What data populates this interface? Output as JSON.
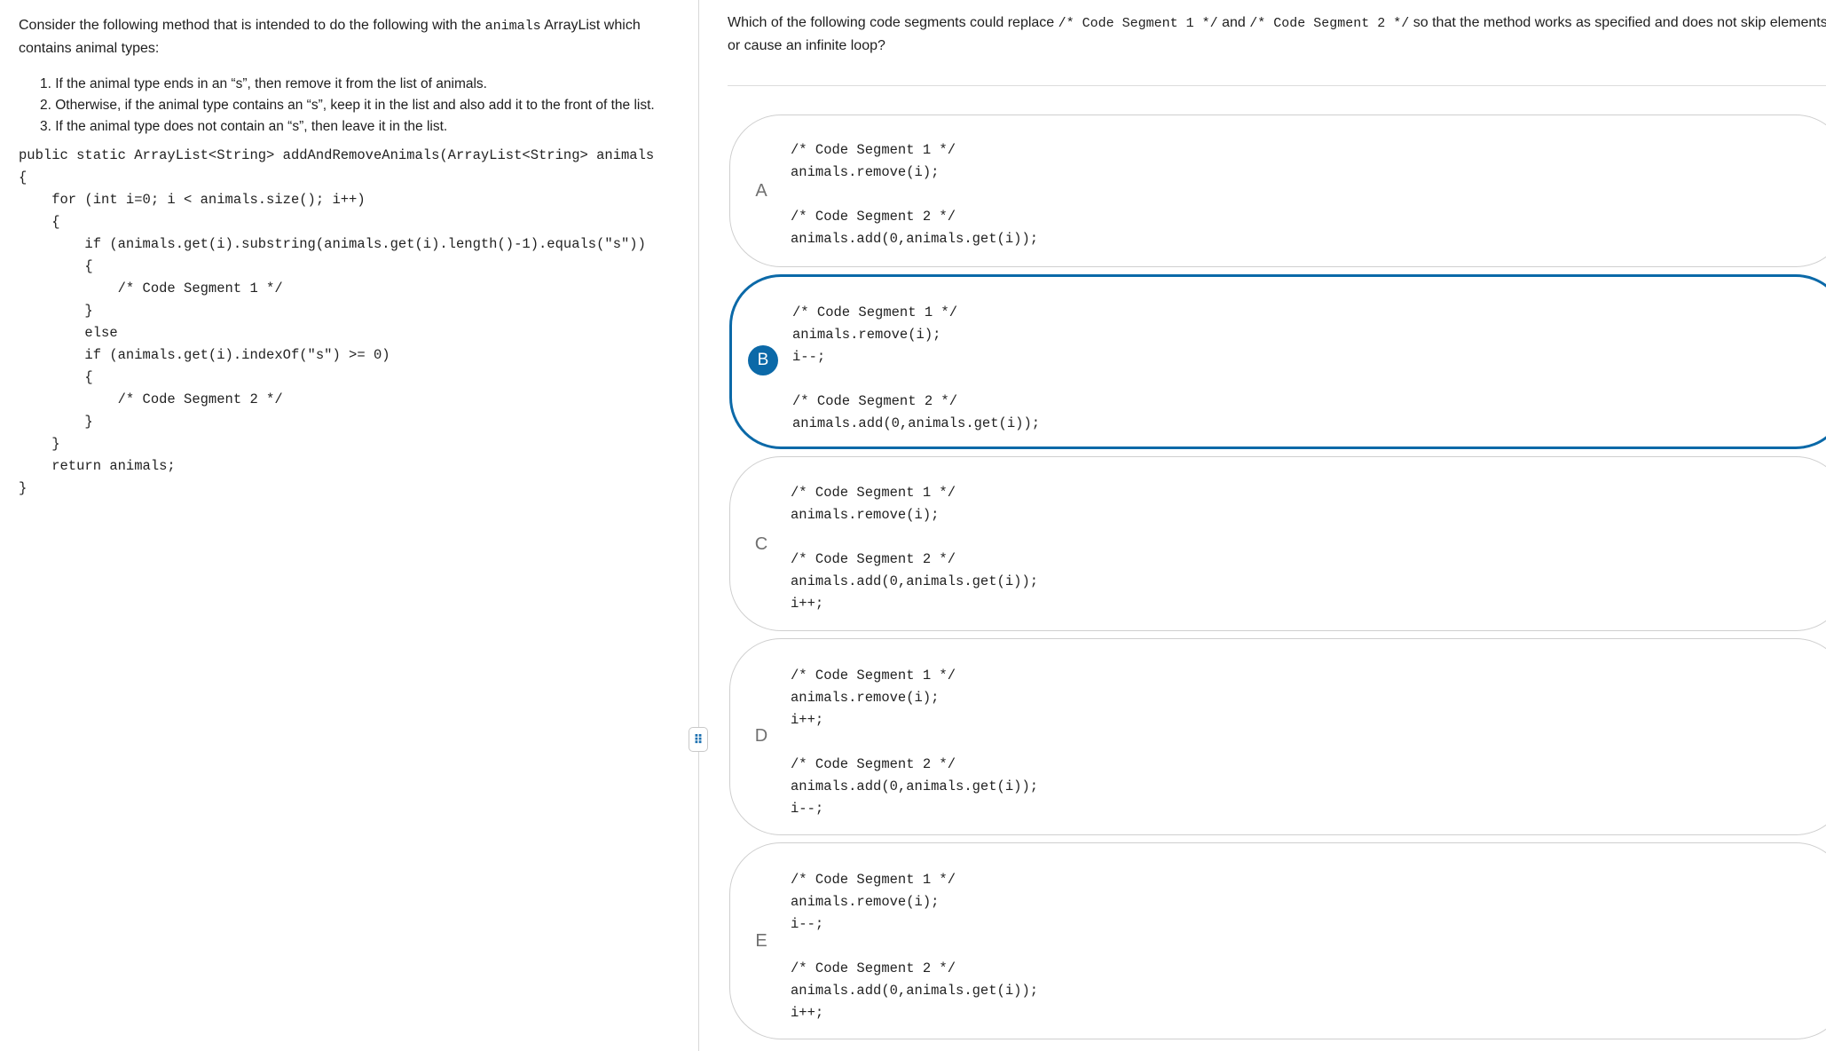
{
  "intro": {
    "before_code": "Consider the following method that is intended to do the following with the ",
    "code_word": "animals",
    "after_code": " ArrayList which contains animal types:"
  },
  "rules": [
    "1. If the animal type ends in an “s”, then remove it from the list of animals.",
    "2. Otherwise, if the animal type contains an “s”, keep it in the list and also add it to the front of the list.",
    "3. If the animal type does not contain an “s”, then leave it in the list."
  ],
  "code": "public static ArrayList<String> addAndRemoveAnimals(ArrayList<String> animals\n{\n    for (int i=0; i < animals.size(); i++)\n    {\n        if (animals.get(i).substring(animals.get(i).length()-1).equals(\"s\"))\n        {\n            /* Code Segment 1 */\n        }\n        else\n        if (animals.get(i).indexOf(\"s\") >= 0)\n        {\n            /* Code Segment 2 */\n        }\n    }\n    return animals;\n}",
  "question": {
    "part1": "Which of the following code segments could replace ",
    "seg1": "/* Code Segment 1 */",
    "part2": " and ",
    "seg2": "/* Code Segment 2 */",
    "part3": " so that the method works as specified and does not skip elements or cause an infinite loop?"
  },
  "handle_glyph": "⠿",
  "selected_option": "B",
  "options": [
    {
      "letter": "A",
      "code": "/* Code Segment 1 */\nanimals.remove(i);\n\n/* Code Segment 2 */\nanimals.add(0,animals.get(i));"
    },
    {
      "letter": "B",
      "code": "/* Code Segment 1 */\nanimals.remove(i);\ni--;\n\n/* Code Segment 2 */\nanimals.add(0,animals.get(i));"
    },
    {
      "letter": "C",
      "code": "/* Code Segment 1 */\nanimals.remove(i);\n\n/* Code Segment 2 */\nanimals.add(0,animals.get(i));\ni++;"
    },
    {
      "letter": "D",
      "code": "/* Code Segment 1 */\nanimals.remove(i);\ni++;\n\n/* Code Segment 2 */\nanimals.add(0,animals.get(i));\ni--;"
    },
    {
      "letter": "E",
      "code": "/* Code Segment 1 */\nanimals.remove(i);\ni--;\n\n/* Code Segment 2 */\nanimals.add(0,animals.get(i));\ni++;"
    }
  ],
  "colors": {
    "selected_accent": "#0b69a8",
    "border": "#cfcfcf",
    "text": "#1e1e1e"
  }
}
